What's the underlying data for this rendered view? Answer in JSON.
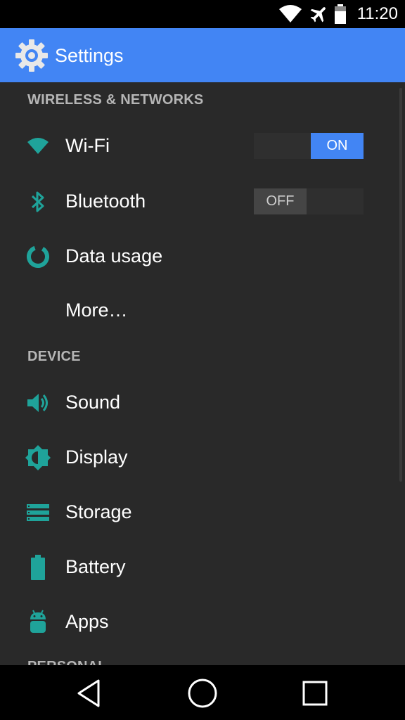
{
  "status_bar": {
    "time": "11:20",
    "icons": [
      "wifi-icon",
      "airplane-mode-icon",
      "battery-icon"
    ]
  },
  "action_bar": {
    "title": "Settings",
    "icon": "settings-gear-icon"
  },
  "sections": [
    {
      "header": "WIRELESS & NETWORKS",
      "items": [
        {
          "label": "Wi-Fi",
          "icon": "wifi-icon",
          "switch": "ON"
        },
        {
          "label": "Bluetooth",
          "icon": "bluetooth-icon",
          "switch": "OFF"
        },
        {
          "label": "Data usage",
          "icon": "data-usage-icon"
        },
        {
          "label": "More…",
          "icon": ""
        }
      ]
    },
    {
      "header": "DEVICE",
      "items": [
        {
          "label": "Sound",
          "icon": "sound-icon"
        },
        {
          "label": "Display",
          "icon": "display-brightness-icon"
        },
        {
          "label": "Storage",
          "icon": "storage-icon"
        },
        {
          "label": "Battery",
          "icon": "battery-icon"
        },
        {
          "label": "Apps",
          "icon": "android-apps-icon"
        }
      ]
    },
    {
      "header": "PERSONAL",
      "items": []
    }
  ],
  "nav_bar": {
    "buttons": [
      "back-icon",
      "home-icon",
      "recents-icon"
    ]
  },
  "colors": {
    "accent": "#4285f4",
    "icon_teal": "#1fa39a",
    "background": "#292929"
  }
}
